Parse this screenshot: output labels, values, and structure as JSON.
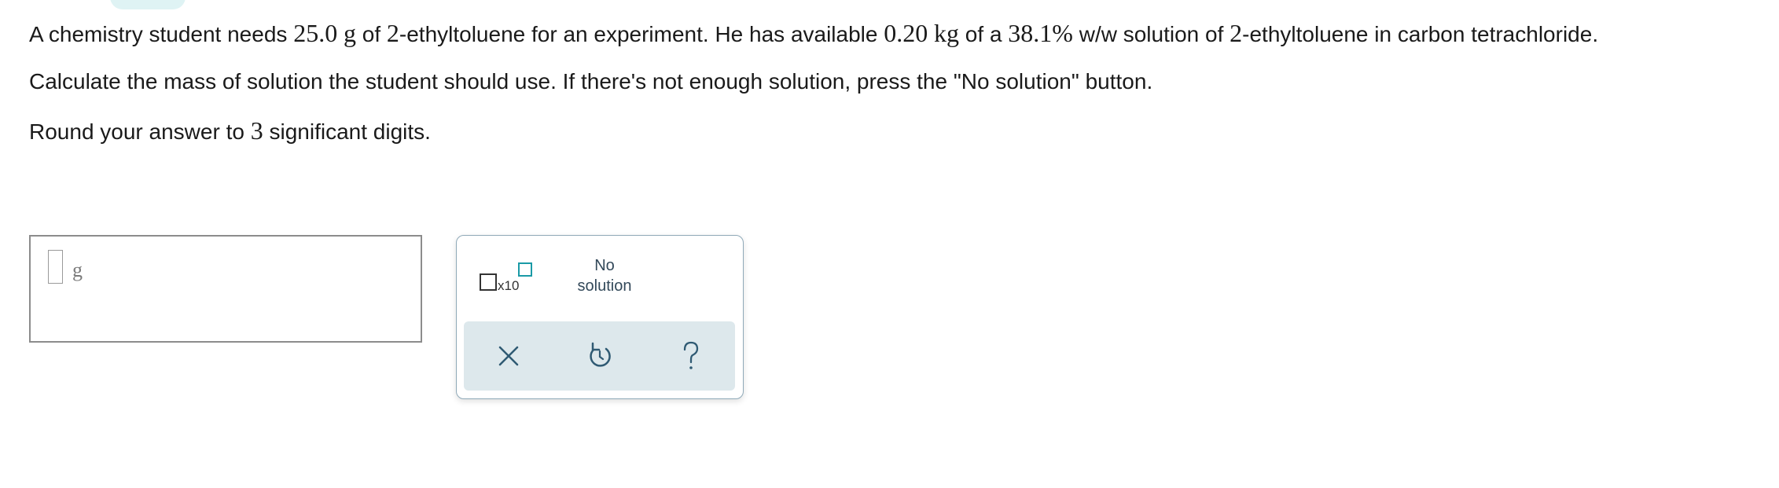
{
  "question": {
    "line1": {
      "t1": "A chemistry student needs ",
      "mass_needed": "25.0",
      "t2": " ",
      "unit_g": "g",
      "t3": " of ",
      "compound_num": "2",
      "t4": "-ethyltoluene for an experiment. He has available ",
      "solution_amount": "0.20",
      "t5": " ",
      "unit_kg": "kg",
      "t6": " of a ",
      "percent": "38.1%",
      "t7": " w/w solution of ",
      "compound_num2": "2",
      "t8": "-ethyltoluene in carbon tetrachloride."
    },
    "line2": "Calculate the mass of solution the student should use. If there's not enough solution, press the \"No solution\" button.",
    "line3": {
      "t1": "Round your answer to ",
      "sig_figs": "3",
      "t2": " significant digits."
    }
  },
  "answer": {
    "value": "",
    "unit": "g"
  },
  "tools": {
    "sci_notation_label": "x10",
    "no_solution_line1": "No",
    "no_solution_line2": "solution"
  },
  "colors": {
    "accent": "#1a9aa6",
    "panel_border": "#8fa9b8",
    "action_bar": "#dde8ec",
    "icon": "#2f5a73"
  },
  "icons": {
    "clear": "x-icon",
    "undo": "undo-icon",
    "help": "question-mark-icon"
  }
}
